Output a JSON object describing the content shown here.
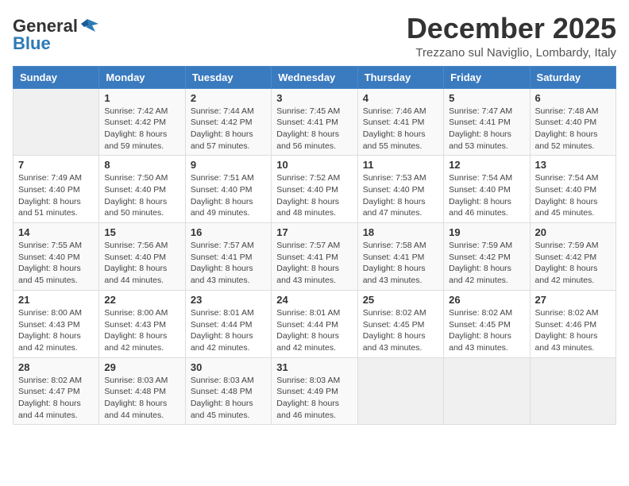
{
  "header": {
    "logo_general": "General",
    "logo_blue": "Blue",
    "title": "December 2025",
    "location": "Trezzano sul Naviglio, Lombardy, Italy"
  },
  "weekdays": [
    "Sunday",
    "Monday",
    "Tuesday",
    "Wednesday",
    "Thursday",
    "Friday",
    "Saturday"
  ],
  "weeks": [
    [
      {
        "day": "",
        "sunrise": "",
        "sunset": "",
        "daylight": ""
      },
      {
        "day": "1",
        "sunrise": "Sunrise: 7:42 AM",
        "sunset": "Sunset: 4:42 PM",
        "daylight": "Daylight: 8 hours and 59 minutes."
      },
      {
        "day": "2",
        "sunrise": "Sunrise: 7:44 AM",
        "sunset": "Sunset: 4:42 PM",
        "daylight": "Daylight: 8 hours and 57 minutes."
      },
      {
        "day": "3",
        "sunrise": "Sunrise: 7:45 AM",
        "sunset": "Sunset: 4:41 PM",
        "daylight": "Daylight: 8 hours and 56 minutes."
      },
      {
        "day": "4",
        "sunrise": "Sunrise: 7:46 AM",
        "sunset": "Sunset: 4:41 PM",
        "daylight": "Daylight: 8 hours and 55 minutes."
      },
      {
        "day": "5",
        "sunrise": "Sunrise: 7:47 AM",
        "sunset": "Sunset: 4:41 PM",
        "daylight": "Daylight: 8 hours and 53 minutes."
      },
      {
        "day": "6",
        "sunrise": "Sunrise: 7:48 AM",
        "sunset": "Sunset: 4:40 PM",
        "daylight": "Daylight: 8 hours and 52 minutes."
      }
    ],
    [
      {
        "day": "7",
        "sunrise": "Sunrise: 7:49 AM",
        "sunset": "Sunset: 4:40 PM",
        "daylight": "Daylight: 8 hours and 51 minutes."
      },
      {
        "day": "8",
        "sunrise": "Sunrise: 7:50 AM",
        "sunset": "Sunset: 4:40 PM",
        "daylight": "Daylight: 8 hours and 50 minutes."
      },
      {
        "day": "9",
        "sunrise": "Sunrise: 7:51 AM",
        "sunset": "Sunset: 4:40 PM",
        "daylight": "Daylight: 8 hours and 49 minutes."
      },
      {
        "day": "10",
        "sunrise": "Sunrise: 7:52 AM",
        "sunset": "Sunset: 4:40 PM",
        "daylight": "Daylight: 8 hours and 48 minutes."
      },
      {
        "day": "11",
        "sunrise": "Sunrise: 7:53 AM",
        "sunset": "Sunset: 4:40 PM",
        "daylight": "Daylight: 8 hours and 47 minutes."
      },
      {
        "day": "12",
        "sunrise": "Sunrise: 7:54 AM",
        "sunset": "Sunset: 4:40 PM",
        "daylight": "Daylight: 8 hours and 46 minutes."
      },
      {
        "day": "13",
        "sunrise": "Sunrise: 7:54 AM",
        "sunset": "Sunset: 4:40 PM",
        "daylight": "Daylight: 8 hours and 45 minutes."
      }
    ],
    [
      {
        "day": "14",
        "sunrise": "Sunrise: 7:55 AM",
        "sunset": "Sunset: 4:40 PM",
        "daylight": "Daylight: 8 hours and 45 minutes."
      },
      {
        "day": "15",
        "sunrise": "Sunrise: 7:56 AM",
        "sunset": "Sunset: 4:40 PM",
        "daylight": "Daylight: 8 hours and 44 minutes."
      },
      {
        "day": "16",
        "sunrise": "Sunrise: 7:57 AM",
        "sunset": "Sunset: 4:41 PM",
        "daylight": "Daylight: 8 hours and 43 minutes."
      },
      {
        "day": "17",
        "sunrise": "Sunrise: 7:57 AM",
        "sunset": "Sunset: 4:41 PM",
        "daylight": "Daylight: 8 hours and 43 minutes."
      },
      {
        "day": "18",
        "sunrise": "Sunrise: 7:58 AM",
        "sunset": "Sunset: 4:41 PM",
        "daylight": "Daylight: 8 hours and 43 minutes."
      },
      {
        "day": "19",
        "sunrise": "Sunrise: 7:59 AM",
        "sunset": "Sunset: 4:42 PM",
        "daylight": "Daylight: 8 hours and 42 minutes."
      },
      {
        "day": "20",
        "sunrise": "Sunrise: 7:59 AM",
        "sunset": "Sunset: 4:42 PM",
        "daylight": "Daylight: 8 hours and 42 minutes."
      }
    ],
    [
      {
        "day": "21",
        "sunrise": "Sunrise: 8:00 AM",
        "sunset": "Sunset: 4:43 PM",
        "daylight": "Daylight: 8 hours and 42 minutes."
      },
      {
        "day": "22",
        "sunrise": "Sunrise: 8:00 AM",
        "sunset": "Sunset: 4:43 PM",
        "daylight": "Daylight: 8 hours and 42 minutes."
      },
      {
        "day": "23",
        "sunrise": "Sunrise: 8:01 AM",
        "sunset": "Sunset: 4:44 PM",
        "daylight": "Daylight: 8 hours and 42 minutes."
      },
      {
        "day": "24",
        "sunrise": "Sunrise: 8:01 AM",
        "sunset": "Sunset: 4:44 PM",
        "daylight": "Daylight: 8 hours and 42 minutes."
      },
      {
        "day": "25",
        "sunrise": "Sunrise: 8:02 AM",
        "sunset": "Sunset: 4:45 PM",
        "daylight": "Daylight: 8 hours and 43 minutes."
      },
      {
        "day": "26",
        "sunrise": "Sunrise: 8:02 AM",
        "sunset": "Sunset: 4:45 PM",
        "daylight": "Daylight: 8 hours and 43 minutes."
      },
      {
        "day": "27",
        "sunrise": "Sunrise: 8:02 AM",
        "sunset": "Sunset: 4:46 PM",
        "daylight": "Daylight: 8 hours and 43 minutes."
      }
    ],
    [
      {
        "day": "28",
        "sunrise": "Sunrise: 8:02 AM",
        "sunset": "Sunset: 4:47 PM",
        "daylight": "Daylight: 8 hours and 44 minutes."
      },
      {
        "day": "29",
        "sunrise": "Sunrise: 8:03 AM",
        "sunset": "Sunset: 4:48 PM",
        "daylight": "Daylight: 8 hours and 44 minutes."
      },
      {
        "day": "30",
        "sunrise": "Sunrise: 8:03 AM",
        "sunset": "Sunset: 4:48 PM",
        "daylight": "Daylight: 8 hours and 45 minutes."
      },
      {
        "day": "31",
        "sunrise": "Sunrise: 8:03 AM",
        "sunset": "Sunset: 4:49 PM",
        "daylight": "Daylight: 8 hours and 46 minutes."
      },
      {
        "day": "",
        "sunrise": "",
        "sunset": "",
        "daylight": ""
      },
      {
        "day": "",
        "sunrise": "",
        "sunset": "",
        "daylight": ""
      },
      {
        "day": "",
        "sunrise": "",
        "sunset": "",
        "daylight": ""
      }
    ]
  ]
}
